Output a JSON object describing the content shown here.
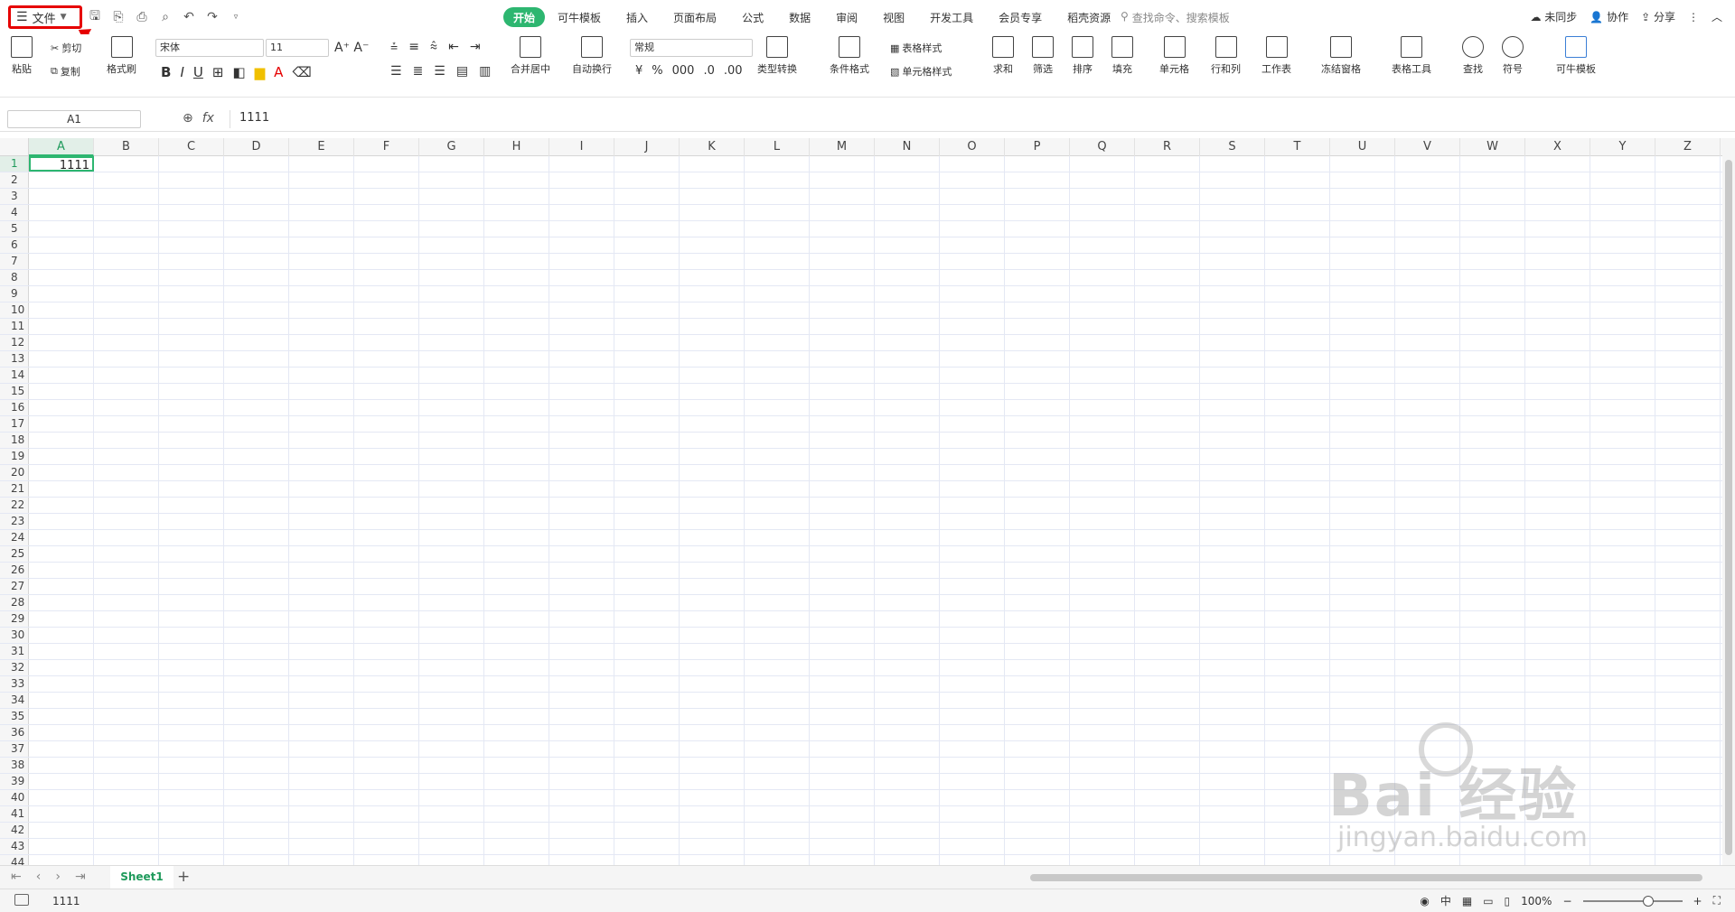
{
  "titlebar": {
    "file_menu": "文件",
    "tabs": [
      "开始",
      "可牛模板",
      "插入",
      "页面布局",
      "公式",
      "数据",
      "审阅",
      "视图",
      "开发工具",
      "会员专享",
      "稻壳资源"
    ],
    "search_placeholder": "查找命令、搜索模板",
    "sync": "未同步",
    "collab": "协作",
    "share": "分享"
  },
  "ribbon": {
    "paste": "粘贴",
    "cut": "剪切",
    "copy": "复制",
    "format_painter": "格式刷",
    "font_name": "宋体",
    "font_size": "11",
    "merge_center": "合并居中",
    "auto_wrap": "自动换行",
    "number_format": "常规",
    "type_convert": "类型转换",
    "cond_format": "条件格式",
    "table_style": "表格样式",
    "cell_style": "单元格样式",
    "sum": "求和",
    "filter": "筛选",
    "sort": "排序",
    "fill": "填充",
    "cell": "单元格",
    "row_col": "行和列",
    "worksheet": "工作表",
    "freeze": "冻结窗格",
    "table_tools": "表格工具",
    "find": "查找",
    "symbol": "符号",
    "template": "可牛模板"
  },
  "formula_bar": {
    "name_box": "A1",
    "fx": "fx",
    "value": "1111"
  },
  "sheet": {
    "columns": [
      "A",
      "B",
      "C",
      "D",
      "E",
      "F",
      "G",
      "H",
      "I",
      "J",
      "K",
      "L",
      "M",
      "N",
      "O",
      "P",
      "Q",
      "R",
      "S",
      "T",
      "U",
      "V",
      "W",
      "X",
      "Y",
      "Z"
    ],
    "rows": [
      "1",
      "2",
      "3",
      "4",
      "5",
      "6",
      "7",
      "8",
      "9",
      "10",
      "11",
      "12",
      "13",
      "14",
      "15",
      "16",
      "17",
      "18",
      "19",
      "20",
      "21",
      "22",
      "23",
      "24",
      "25",
      "26",
      "27",
      "28",
      "29",
      "30",
      "31",
      "32",
      "33",
      "34",
      "35",
      "36",
      "37",
      "38",
      "39",
      "40",
      "41",
      "42",
      "43",
      "44"
    ],
    "a1_value": "1111"
  },
  "sheet_tabs": {
    "active": "Sheet1"
  },
  "status": {
    "value": "1111",
    "zoom": "100%"
  },
  "watermark": {
    "brand": "Bai 经验",
    "url": "jingyan.baidu.com"
  },
  "colors": {
    "accent": "#2db670",
    "highlight": "#e60000"
  }
}
